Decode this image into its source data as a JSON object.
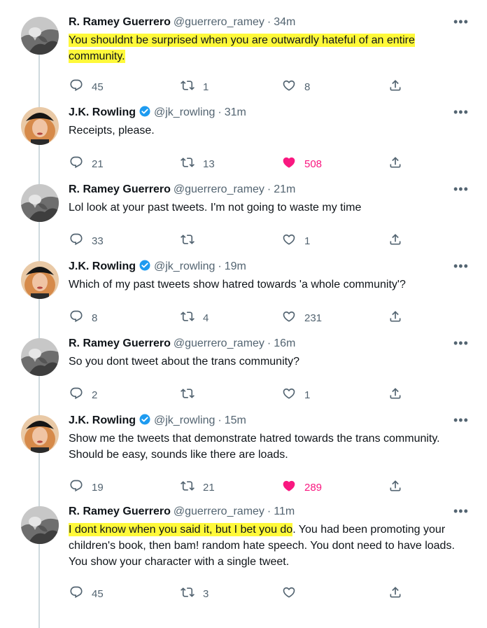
{
  "tweets": [
    {
      "author": "R. Ramey Guerrero",
      "handle": "@guerrero_ramey",
      "time": "34m",
      "verified": false,
      "avatar": "bw-photo",
      "highlight": "You shouldnt be surprised when you are outwardly hateful of an entire community.",
      "text": "",
      "replies": "45",
      "retweets": "1",
      "likes": "8",
      "liked": false
    },
    {
      "author": "J.K. Rowling",
      "handle": "@jk_rowling",
      "time": "31m",
      "verified": true,
      "avatar": "color-photo",
      "highlight": "",
      "text": "Receipts, please.",
      "replies": "21",
      "retweets": "13",
      "likes": "508",
      "liked": true
    },
    {
      "author": "R. Ramey Guerrero",
      "handle": "@guerrero_ramey",
      "time": "21m",
      "verified": false,
      "avatar": "bw-photo",
      "highlight": "",
      "text": "Lol look at your past tweets. I'm not going to waste my time",
      "replies": "33",
      "retweets": "",
      "likes": "1",
      "liked": false
    },
    {
      "author": "J.K. Rowling",
      "handle": "@jk_rowling",
      "time": "19m",
      "verified": true,
      "avatar": "color-photo",
      "highlight": "",
      "text": "Which of my past tweets show hatred towards 'a whole community'?",
      "replies": "8",
      "retweets": "4",
      "likes": "231",
      "liked": false
    },
    {
      "author": "R. Ramey Guerrero",
      "handle": "@guerrero_ramey",
      "time": "16m",
      "verified": false,
      "avatar": "bw-photo",
      "highlight": "",
      "text": "So you dont tweet about the trans community?",
      "replies": "2",
      "retweets": "",
      "likes": "1",
      "liked": false
    },
    {
      "author": "J.K. Rowling",
      "handle": "@jk_rowling",
      "time": "15m",
      "verified": true,
      "avatar": "color-photo",
      "highlight": "",
      "text": "Show me the tweets that demonstrate hatred towards the trans community. Should be easy, sounds like there are loads.",
      "replies": "19",
      "retweets": "21",
      "likes": "289",
      "liked": true
    },
    {
      "author": "R. Ramey Guerrero",
      "handle": "@guerrero_ramey",
      "time": "11m",
      "verified": false,
      "avatar": "bw-photo",
      "highlight": "I dont know when you said it, but I bet you do",
      "text": ". You had been promoting your children's book, then bam! random hate speech. You dont need to have loads. You show your character with a single tweet.",
      "replies": "45",
      "retweets": "3",
      "likes": "",
      "liked": false
    }
  ],
  "icons": {
    "reply": "reply-icon",
    "retweet": "retweet-icon",
    "like": "heart-icon",
    "share": "share-icon",
    "more": "more-icon",
    "verified": "verified-badge-icon"
  },
  "colors": {
    "muted": "#536471",
    "like": "#f91880",
    "highlight": "#fff93a",
    "verified": "#1d9bf0"
  }
}
